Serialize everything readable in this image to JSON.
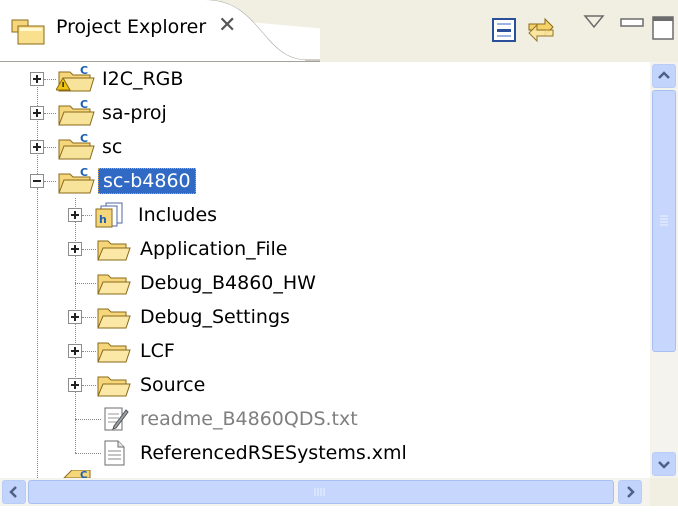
{
  "view": {
    "tab_title": "Project Explorer",
    "tab_icon": "project-explorer-icon",
    "toolbar": {
      "collapse_all_icon": "collapse-all-icon",
      "link_with_editor_icon": "link-with-editor-icon",
      "view_menu_icon": "view-menu-icon",
      "minimize_icon": "minimize-icon",
      "maximize_icon": "maximize-icon"
    }
  },
  "tree": {
    "projects": [
      {
        "label": "I2C_RGB",
        "expanded": false,
        "warning": true
      },
      {
        "label": "sa-proj",
        "expanded": false
      },
      {
        "label": "sc",
        "expanded": false
      },
      {
        "label": "sc-b4860",
        "expanded": true,
        "selected": true
      }
    ],
    "children": [
      {
        "label": "Includes",
        "icon": "includes-icon",
        "expandable": true
      },
      {
        "label": "Application_File",
        "icon": "folder-icon",
        "expandable": true
      },
      {
        "label": "Debug_B4860_HW",
        "icon": "folder-icon",
        "expandable": false
      },
      {
        "label": "Debug_Settings",
        "icon": "folder-icon",
        "expandable": true
      },
      {
        "label": "LCF",
        "icon": "folder-icon",
        "expandable": true
      },
      {
        "label": "Source",
        "icon": "folder-icon",
        "expandable": true
      },
      {
        "label": "readme_B4860QDS.txt",
        "icon": "text-file-icon",
        "expandable": false,
        "muted": true
      },
      {
        "label": "ReferencedRSESystems.xml",
        "icon": "xml-file-icon",
        "expandable": false
      }
    ]
  },
  "colors": {
    "selection": "#316ac5",
    "title_bar": "#f1efe2",
    "scrollbar": "#c6d6fc",
    "folder": "#f5d67a"
  }
}
